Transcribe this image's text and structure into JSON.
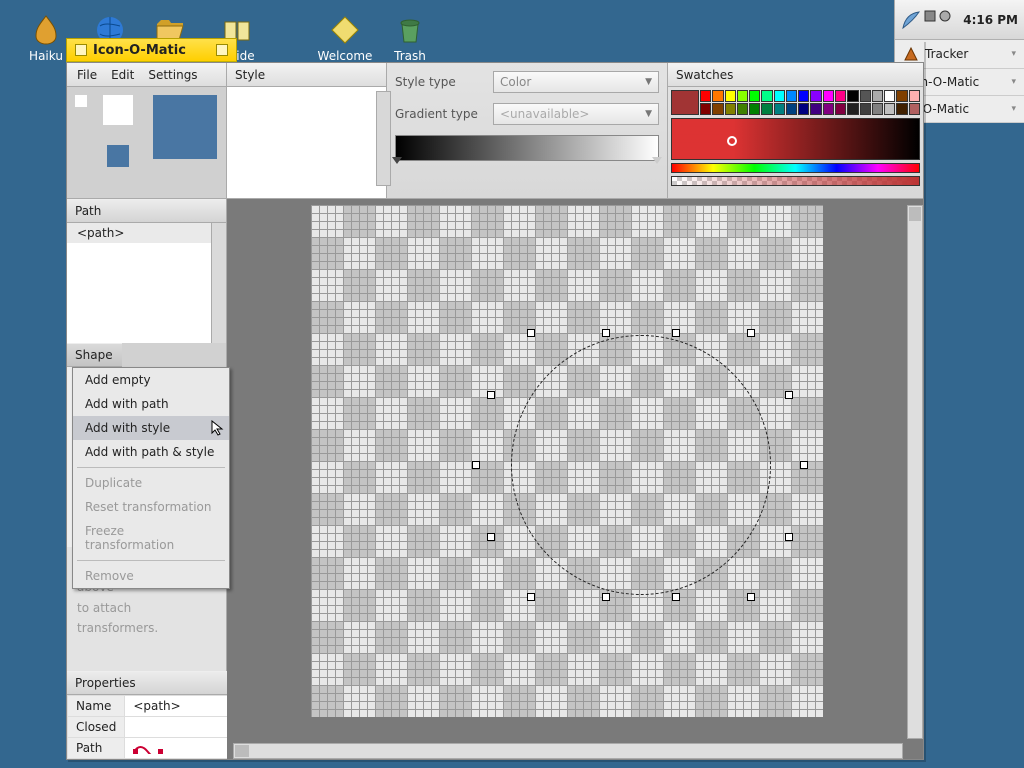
{
  "desktop": {
    "icons": [
      {
        "label": "Haiku"
      },
      {
        "label": "Guide"
      },
      {
        "label": "Welcome"
      },
      {
        "label": "Trash"
      }
    ]
  },
  "taskbar": {
    "clock": "4:16 PM",
    "items": [
      {
        "label": "Tracker"
      },
      {
        "label": "Icon-O-Matic"
      },
      {
        "label": "on-O-Matic"
      }
    ]
  },
  "window": {
    "title": "Icon-O-Matic",
    "menu": {
      "file": "File",
      "edit": "Edit",
      "settings": "Settings"
    },
    "style_header": "Style",
    "style_type_label": "Style type",
    "style_type_value": "Color",
    "gradient_type_label": "Gradient type",
    "gradient_type_value": "<unavailable>",
    "swatches_header": "Swatches",
    "swatch_colors_row1": [
      "#f00",
      "#f70",
      "#ff0",
      "#8f0",
      "#0f0",
      "#0f8",
      "#0ff",
      "#08f",
      "#00f",
      "#80f",
      "#f0f",
      "#f08",
      "#000",
      "#555",
      "#aaa",
      "#fff",
      "#804000",
      "#ffb0b0"
    ],
    "swatch_colors_row2": [
      "#800000",
      "#804000",
      "#808000",
      "#408000",
      "#008000",
      "#008040",
      "#008080",
      "#004080",
      "#000080",
      "#400080",
      "#800080",
      "#800040",
      "#202020",
      "#404040",
      "#808080",
      "#c0c0c0",
      "#402000",
      "#b06060"
    ]
  },
  "path": {
    "header": "Path",
    "item": "<path>"
  },
  "shape": {
    "header": "Shape"
  },
  "context_menu": {
    "items": [
      {
        "label": "Add empty",
        "disabled": false
      },
      {
        "label": "Add with path",
        "disabled": false
      },
      {
        "label": "Add with style",
        "disabled": false,
        "hover": true
      },
      {
        "label": "Add with path & style",
        "disabled": false
      }
    ],
    "items2": [
      {
        "label": "Duplicate",
        "disabled": true
      },
      {
        "label": "Reset transformation",
        "disabled": true
      },
      {
        "label": "Freeze transformation",
        "disabled": true
      }
    ],
    "items3": [
      {
        "label": "Remove",
        "disabled": true
      }
    ]
  },
  "transformer": {
    "hint1": "Click on a shape above",
    "hint2": "to attach transformers."
  },
  "properties": {
    "header": "Properties",
    "rows": {
      "name_label": "Name",
      "name_value": "<path>",
      "closed_label": "Closed",
      "path_label": "Path"
    }
  }
}
